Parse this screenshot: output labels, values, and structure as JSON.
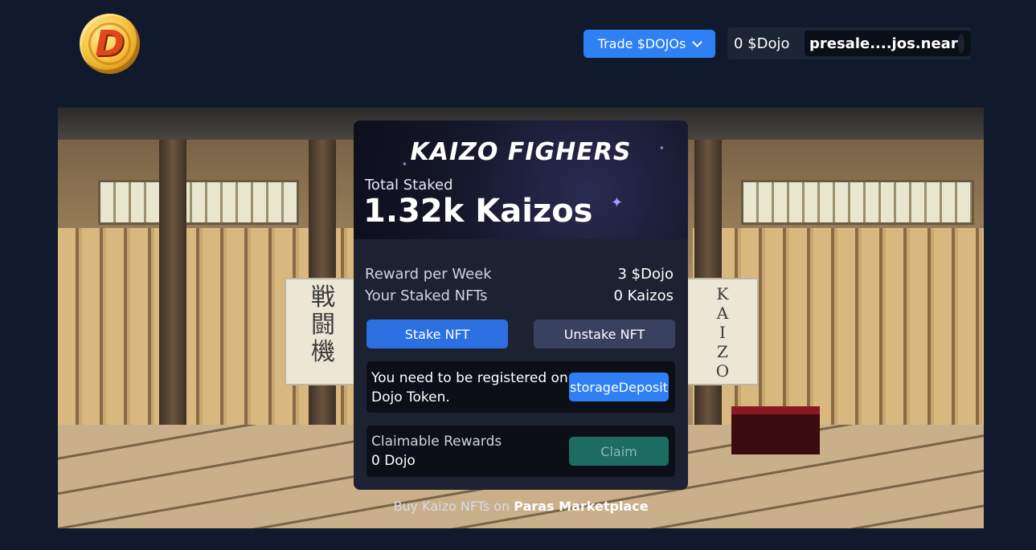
{
  "header": {
    "logo_alt": "Dojo logo",
    "logo_letter": "D",
    "trade_button": "Trade $DOJOs",
    "wallet_balance": "0 $Dojo",
    "wallet_account": "presale....jos.near"
  },
  "banner": {
    "scroll_left_glyphs": "戦\n闘\n機",
    "scroll_right_glyphs": "K\nA\nI\nZ\nO"
  },
  "card": {
    "title": "KAIZO FIGHERS",
    "total_staked_label": "Total Staked",
    "total_staked_value": "1.32k Kaizos",
    "reward_label": "Reward per Week",
    "reward_value": "3 $Dojo",
    "your_staked_label": "Your Staked NFTs",
    "your_staked_value": "0 Kaizos",
    "stake_button": "Stake NFT",
    "unstake_button": "Unstake NFT",
    "register_text": "You need to be registered on Dojo Token.",
    "deposit_button": "storageDeposit",
    "claimable_label": "Claimable Rewards",
    "claimable_value": "0 Dojo",
    "claim_button": "Claim"
  },
  "footer": {
    "buy_prefix": "Buy Kaizo NFTs on ",
    "buy_link": "Paras Marketplace"
  },
  "colors": {
    "page_bg": "#111a2c",
    "primary_blue": "#2f7ff5",
    "card_bg": "#1d2232",
    "claim_btn": "#1d6c63"
  }
}
